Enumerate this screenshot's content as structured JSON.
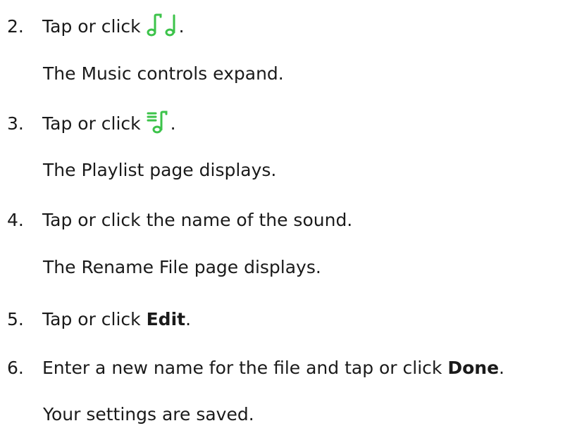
{
  "accent_color": "#3cc34a",
  "steps": [
    {
      "number": "2.",
      "text_before": "Tap or click ",
      "icon": "music-notes-icon",
      "text_after": ".",
      "result": "The Music controls expand."
    },
    {
      "number": "3.",
      "text_before": "Tap or click ",
      "icon": "playlist-icon",
      "text_after": ".",
      "result": "The Playlist page displays."
    },
    {
      "number": "4.",
      "text": "Tap or click the name of the sound.",
      "result": "The Rename File page displays."
    },
    {
      "number": "5.",
      "text_before": "Tap or click ",
      "bold": "Edit",
      "text_after": "."
    },
    {
      "number": "6.",
      "text_before": "Enter a new name for the file and tap or click ",
      "bold": "Done",
      "text_after": ".",
      "result": "Your settings are saved."
    }
  ]
}
